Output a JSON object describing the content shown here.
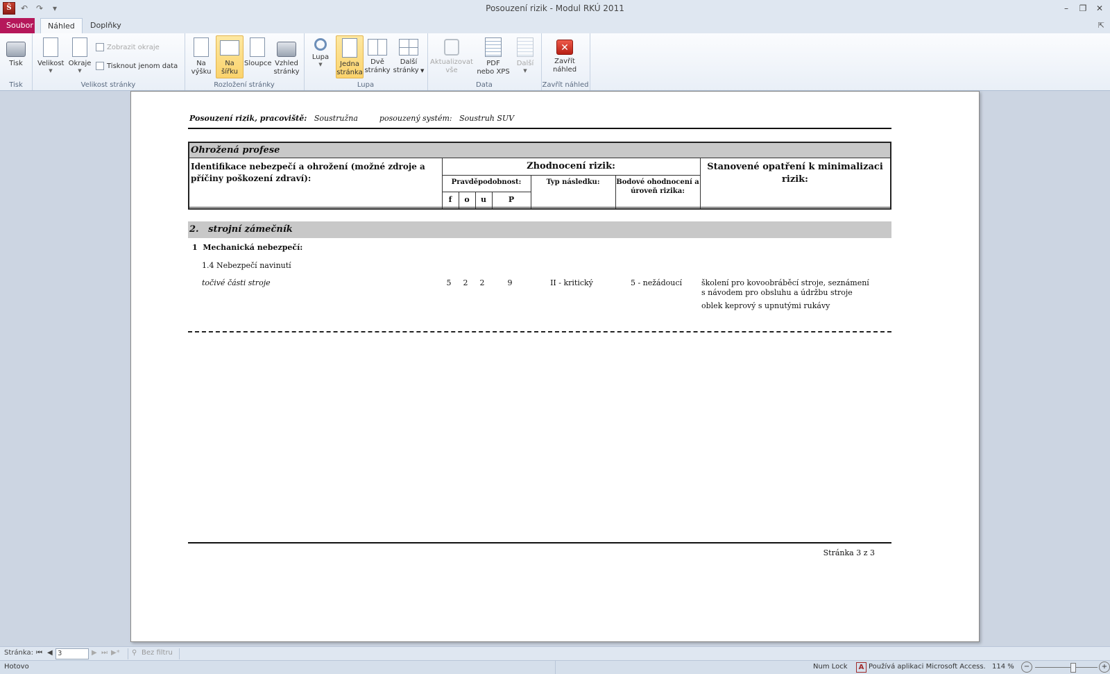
{
  "window": {
    "title": "Posouzení rizik - Modul RKÚ 2011",
    "app_icon": "Ŝ"
  },
  "tabs": {
    "file": "Soubor",
    "active": "Náhled",
    "extra": "Doplňky"
  },
  "ribbon": {
    "groups": {
      "tisk": "Tisk",
      "velikost": "Velikost stránky",
      "rozlozeni": "Rozložení stránky",
      "lupa": "Lupa",
      "data": "Data",
      "zavrit": "Zavřít náhled"
    },
    "buttons": {
      "tisk": "Tisk",
      "velikost": "Velikost",
      "okraje": "Okraje",
      "zobrazit_okraje": "Zobrazit okraje",
      "tisknout_data": "Tisknout jenom data",
      "na_vysku_1": "Na",
      "na_vysku_2": "výšku",
      "na_sirku_1": "Na",
      "na_sirku_2": "šířku",
      "sloupce": "Sloupce",
      "vzhled_1": "Vzhled",
      "vzhled_2": "stránky",
      "lupa": "Lupa",
      "jedna_1": "Jedna",
      "jedna_2": "stránka",
      "dve_1": "Dvě",
      "dve_2": "stránky",
      "dalsi_str_1": "Další",
      "dalsi_str_2": "stránky",
      "aktualizovat_1": "Aktualizovat",
      "aktualizovat_2": "vše",
      "pdf_1": "PDF",
      "pdf_2": "nebo XPS",
      "dalsi": "Další",
      "zavrit_1": "Zavřít",
      "zavrit_2": "náhled"
    }
  },
  "report": {
    "header_label": "Posouzení rizik, pracoviště:",
    "workplace": "Soustružna",
    "system_label": "posouzený systém:",
    "system": "Soustruh SUV",
    "band_title": "Ohrožená profese",
    "col_identifikace": "Identifikace nebezpečí a ohrožení (možné zdroje a příčiny poškození zdraví):",
    "col_zhodnoceni": "Zhodnocení rizik:",
    "col_pravdepodobnost": "Pravděpodobnost:",
    "col_f": "f",
    "col_o": "o",
    "col_u": "u",
    "col_p": "P",
    "col_typ": "Typ následku:",
    "col_bodove": "Bodové ohodnocení a úroveň rizika:",
    "col_opatreni": "Stanovené opatření k minimalizaci rizik:",
    "section_number": "2.",
    "section_title": "strojní zámečník",
    "category": "1  Mechanická nebezpečí:",
    "subcategory": "1.4 Nebezpečí navinutí",
    "row": {
      "source": "točivé části stroje",
      "f": "5",
      "o": "2",
      "u": "2",
      "p": "9",
      "typ": "II - kritický",
      "uroven": "5 - nežádoucí",
      "opatreni_1": "školení pro kovoobráběcí stroje, seznámení s návodem pro obsluhu a údržbu stroje",
      "opatreni_2": "oblek keprový s upnutými rukávy"
    },
    "footer_page": "Stránka 3 z 3"
  },
  "navigation": {
    "label": "Stránka:",
    "page_value": "3",
    "filter": "Bez filtru"
  },
  "status": {
    "left": "Hotovo",
    "numlock": "Num Lock",
    "access": "Používá aplikaci Microsoft Access.",
    "zoom": "114 %",
    "zoom_fraction": 0.61
  },
  "colors": {
    "file_tab": "#b5175a",
    "selected_button": "#fbd36c",
    "close_red": "#d03a2c"
  }
}
